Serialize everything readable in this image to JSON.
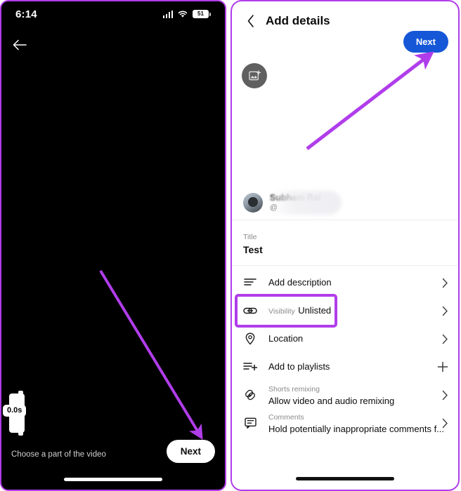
{
  "accent_color": "#b03dea",
  "left_phone": {
    "name": "youtube-shorts-trim-screen",
    "status_bar": {
      "time": "6:14",
      "battery_level": "51",
      "signal_icon": "cellular-signal-icon",
      "wifi_icon": "wifi-icon",
      "battery_icon": "battery-icon"
    },
    "back_icon": "back-arrow-icon",
    "trimmer": {
      "duration_label": "0.0s",
      "handle_icon": "trim-handle-icon"
    },
    "hint_text": "Choose a part of the video",
    "next_label": "Next",
    "home_indicator": "home-indicator"
  },
  "right_phone": {
    "name": "youtube-add-details-screen",
    "header": {
      "back_icon": "chevron-left-icon",
      "title": "Add details",
      "next_label": "Next"
    },
    "thumbnail": {
      "icon": "add-thumbnail-icon"
    },
    "profile": {
      "name": "Subham Rai",
      "handle": "@",
      "avatar_icon": "avatar"
    },
    "title_field": {
      "label": "Title",
      "value": "Test"
    },
    "options": [
      {
        "icon": "description-icon",
        "label": "Add description",
        "sublabel": "",
        "end_icon": "chevron-right-icon",
        "highlighted": false
      },
      {
        "icon": "link-icon",
        "label": "Unlisted",
        "sublabel": "Visibility",
        "end_icon": "chevron-right-icon",
        "highlighted": true
      },
      {
        "icon": "location-pin-icon",
        "label": "Location",
        "sublabel": "",
        "end_icon": "chevron-right-icon",
        "highlighted": false
      },
      {
        "icon": "playlist-add-icon",
        "label": "Add to playlists",
        "sublabel": "",
        "end_icon": "plus-icon",
        "highlighted": false
      },
      {
        "icon": "shorts-remix-icon",
        "label": "Allow video and audio remixing",
        "sublabel": "Shorts remixing",
        "end_icon": "chevron-right-icon",
        "highlighted": false
      },
      {
        "icon": "comment-icon",
        "label": "Hold potentially inappropriate comments f...",
        "sublabel": "Comments",
        "end_icon": "chevron-right-icon",
        "highlighted": false
      }
    ],
    "home_indicator": "home-indicator"
  }
}
